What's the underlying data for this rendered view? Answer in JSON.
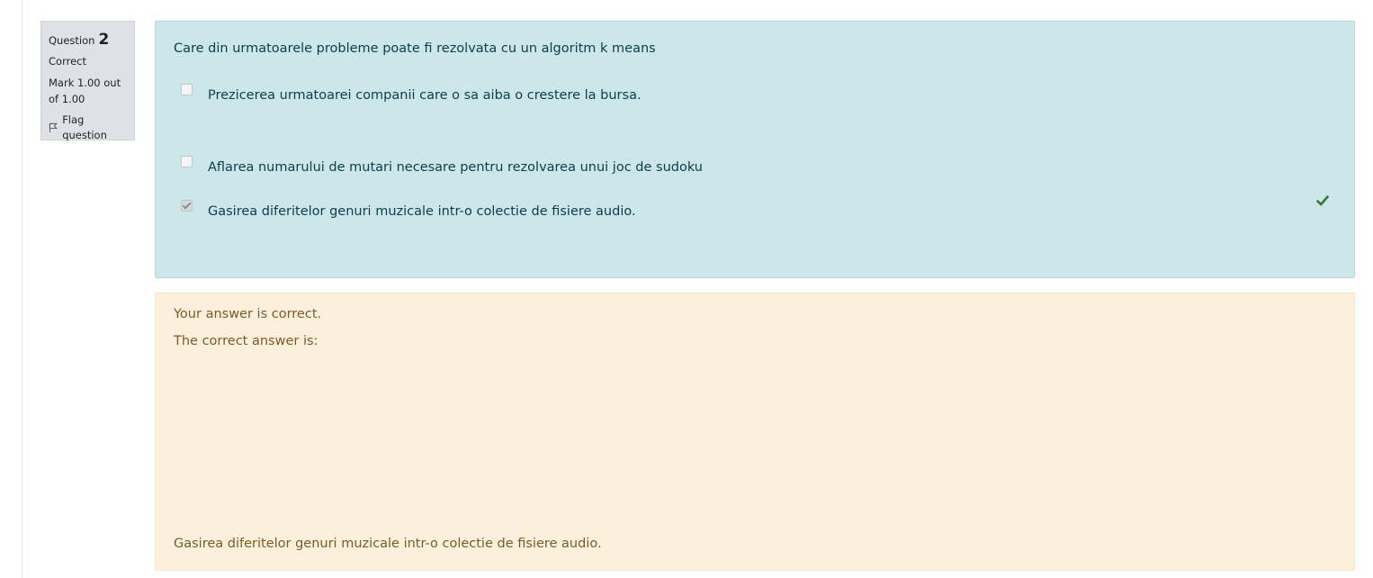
{
  "info": {
    "question_label": "Question",
    "question_number": "2",
    "state": "Correct",
    "grade": "Mark 1.00 out of 1.00",
    "flag_label": "Flag question"
  },
  "question": {
    "text": "Care din urmatoarele probleme poate fi rezolvata cu un algoritm k means",
    "options": [
      {
        "label": "Prezicerea urmatoarei companii care o sa aiba o crestere la bursa.",
        "checked": false
      },
      {
        "label": "Aflarea numarului de mutari necesare pentru rezolvarea unui joc de sudoku",
        "checked": false
      },
      {
        "label": "Gasirea diferitelor genuri muzicale intr-o colectie de fisiere audio.",
        "checked": true
      }
    ],
    "correct_icon": "check-icon"
  },
  "outcome": {
    "feedback": "Your answer is correct.",
    "right_answer_intro": "The correct answer is:",
    "right_answer": "Gasirea diferitelor genuri muzicale intr-o colectie de fisiere audio."
  },
  "colors": {
    "content_bg": "#cce6ea",
    "outcome_bg": "#fcefdc",
    "info_bg": "#dee2e6",
    "correct_green": "#357a32"
  }
}
